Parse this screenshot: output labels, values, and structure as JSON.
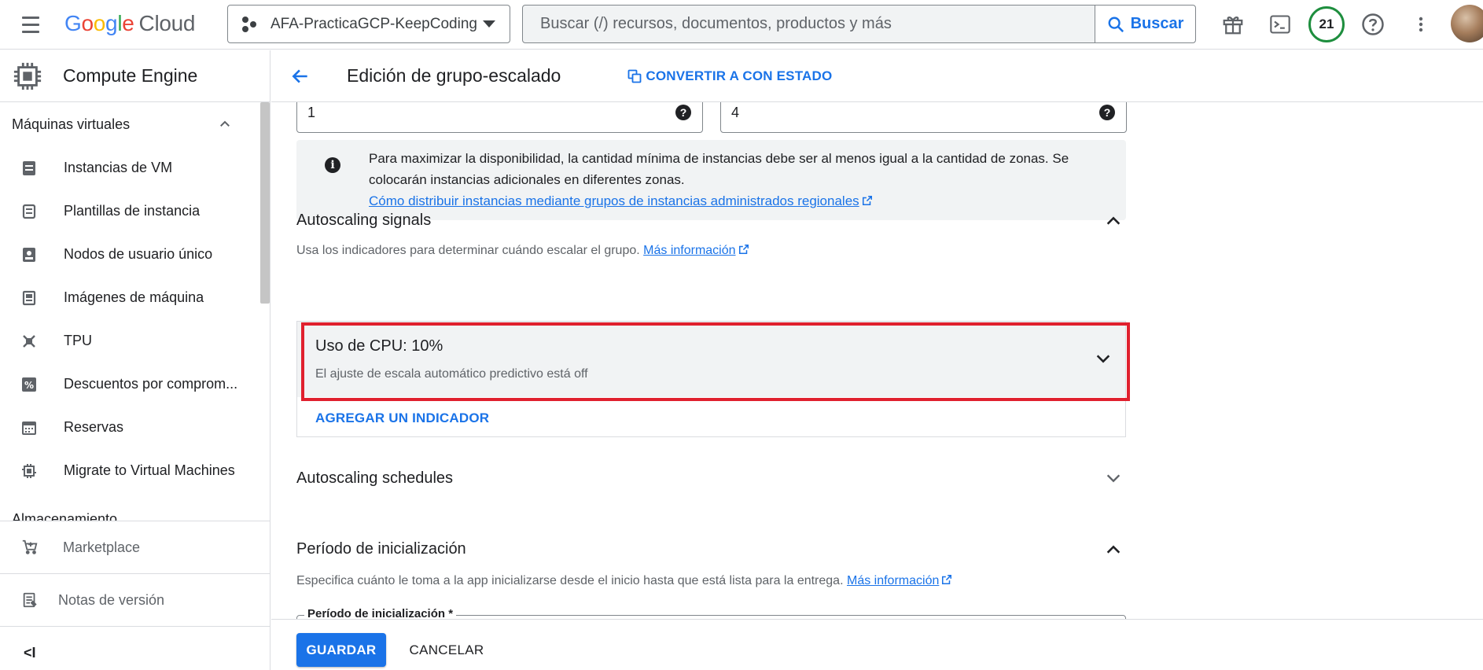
{
  "topbar": {
    "logo_google": "Google",
    "logo_cloud": "Cloud",
    "project_name": "AFA-PracticaGCP-KeepCoding",
    "search_placeholder": "Buscar (/) recursos, documentos, productos y más",
    "search_button": "Buscar",
    "notification_count": "21"
  },
  "sidebar": {
    "product": "Compute Engine",
    "section": "Máquinas virtuales",
    "items": [
      {
        "label": "Instancias de VM",
        "icon": "vm-instance-icon"
      },
      {
        "label": "Plantillas de instancia",
        "icon": "template-icon"
      },
      {
        "label": "Nodos de usuario único",
        "icon": "sole-tenant-icon"
      },
      {
        "label": "Imágenes de máquina",
        "icon": "machine-image-icon"
      },
      {
        "label": "TPU",
        "icon": "tpu-icon"
      },
      {
        "label": "Descuentos por comprom...",
        "icon": "discount-icon"
      },
      {
        "label": "Reservas",
        "icon": "calendar-icon"
      },
      {
        "label": "Migrate to Virtual Machines",
        "icon": "migrate-icon"
      }
    ],
    "next_section_cut": "Almacenamiento",
    "marketplace": "Marketplace",
    "release_notes": "Notas de versión",
    "collapse": "<I"
  },
  "header": {
    "title": "Edición de grupo-escalado",
    "convert_button": "CONVERTIR A CON ESTADO"
  },
  "form": {
    "min_instances": "1",
    "max_instances": "4",
    "info_text": "Para maximizar la disponibilidad, la cantidad mínima de instancias debe ser al menos igual a la cantidad de zonas. Se colocarán instancias adicionales en diferentes zonas.",
    "info_link": "Cómo distribuir instancias mediante grupos de instancias administrados regionales",
    "signals_title": "Autoscaling signals",
    "signals_desc": "Usa los indicadores para determinar cuándo escalar el grupo.",
    "signals_link": "Más información",
    "cpu_title": "Uso de CPU: 10%",
    "cpu_sub": "El ajuste de escala automático predictivo está off",
    "add_indicator": "AGREGAR UN INDICADOR",
    "schedules_title": "Autoscaling schedules",
    "init_title": "Período de inicialización",
    "init_desc": "Especifica cuánto le toma a la app inicializarse desde el inicio hasta que está lista para la entrega.",
    "init_link": "Más información",
    "init_field_label": "Período de inicialización *"
  },
  "footer": {
    "save": "GUARDAR",
    "cancel": "CANCELAR"
  },
  "colors": {
    "accent": "#1a73e8",
    "highlight": "#e0202e",
    "badge_ring": "#1e8e3e"
  }
}
